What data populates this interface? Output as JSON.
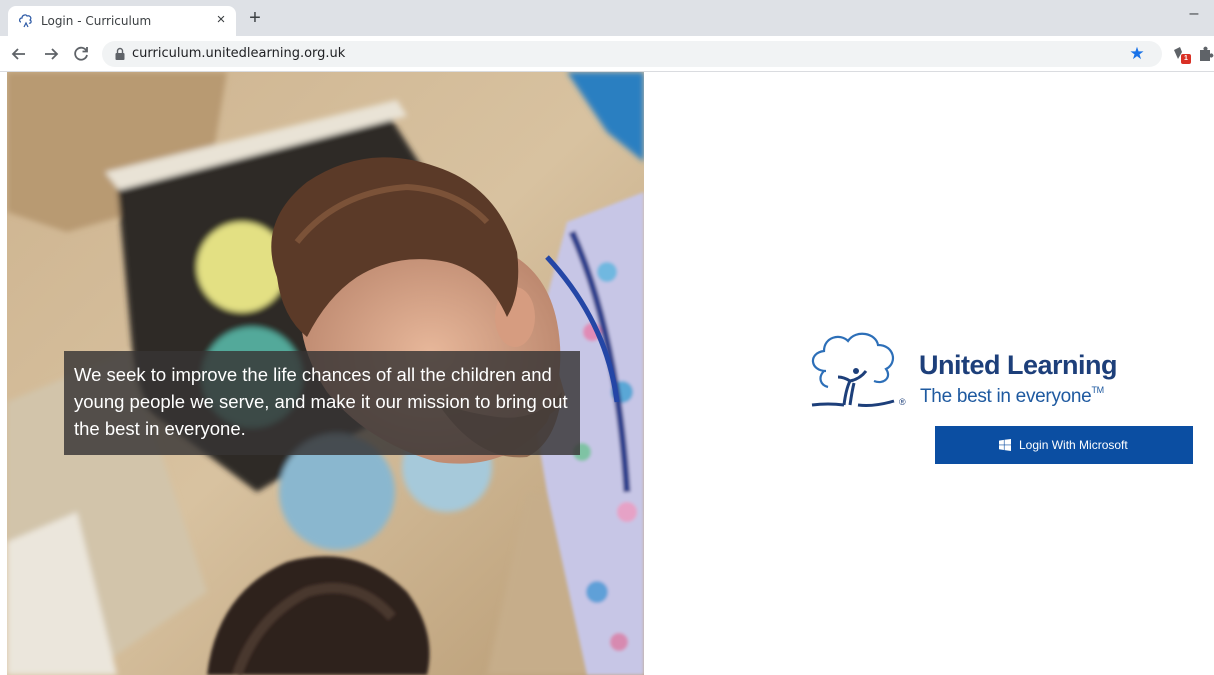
{
  "browser": {
    "tab_title": "Login - Curriculum",
    "tab_close_symbol": "×",
    "new_tab_symbol": "+",
    "minimize_symbol": "–",
    "url": "curriculum.unitedlearning.org.uk",
    "bookmark_symbol": "★",
    "extension_badge": "1",
    "icons": [
      "back-arrow-icon",
      "forward-arrow-icon",
      "reload-icon",
      "lock-icon",
      "star-icon",
      "extension-icon",
      "puzzle-icon"
    ]
  },
  "hero": {
    "mission_statement": "We seek to improve the life chances of all the children and young people we serve, and make it our mission to bring out the best in everyone."
  },
  "brand": {
    "name": "United Learning",
    "tagline": "The best in everyone",
    "trademark": "TM",
    "registered": "®",
    "color": "#1d3f7a"
  },
  "login": {
    "button_label": "Login With Microsoft",
    "button_color": "#0b4ea2"
  }
}
